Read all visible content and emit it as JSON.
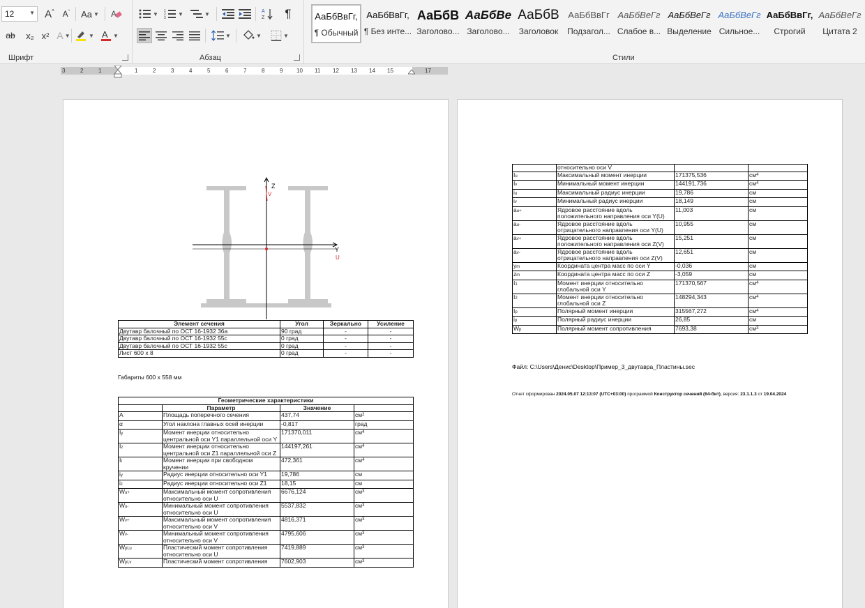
{
  "ribbon": {
    "font_size": "12",
    "font_group_label": "Шрифт",
    "para_group_label": "Абзац",
    "styles_group_label": "Стили",
    "case_label": "Aa",
    "grow_font": "A",
    "shrink_font": "A",
    "subscript": "x₂",
    "superscript": "x²",
    "font_color_letter": "A",
    "pilcrow": "¶"
  },
  "styles": [
    {
      "preview": "АаБбВвГг,",
      "name": "¶ Обычный"
    },
    {
      "preview": "АаБбВвГг,",
      "name": "¶ Без инте..."
    },
    {
      "preview": "АаБбВ",
      "name": "Заголово..."
    },
    {
      "preview": "АаБбВе",
      "name": "Заголово..."
    },
    {
      "preview": "АаБбВ",
      "name": "Заголовок"
    },
    {
      "preview": "АаБбВвГг",
      "name": "Подзагол..."
    },
    {
      "preview": "АаБбВеГг",
      "name": "Слабое в..."
    },
    {
      "preview": "АаБбВеГг",
      "name": "Выделение"
    },
    {
      "preview": "АаБбВеГг",
      "name": "Сильное..."
    },
    {
      "preview": "АаБбВвГг,",
      "name": "Строгий"
    },
    {
      "preview": "АаБбВеГг",
      "name": "Цитата 2"
    }
  ],
  "ruler": {
    "left_labels": [
      "3",
      "2",
      "1"
    ],
    "right_labels": [
      "1",
      "2",
      "3",
      "4",
      "5",
      "6",
      "7",
      "8",
      "9",
      "10",
      "11",
      "12",
      "13",
      "14",
      "15",
      "17"
    ]
  },
  "drawing": {
    "axis_z": "Z",
    "axis_y": "Y",
    "axis_v": "V",
    "axis_u": "U"
  },
  "elements_table": {
    "headers": [
      "Элемент сечения",
      "Угол",
      "Зеркально",
      "Усиление"
    ],
    "rows": [
      [
        "Двутавр балочный по ОСТ 16-1932 36а",
        "90 град",
        "-",
        "-"
      ],
      [
        "Двутавр балочный по ОСТ 16-1932 55с",
        "0 град",
        "-",
        "-"
      ],
      [
        "Двутавр балочный по ОСТ 16-1932 55с",
        "0 град",
        "-",
        "-"
      ],
      [
        "Лист 600 x 8",
        "0 град",
        "-",
        "-"
      ]
    ]
  },
  "dimensions_text": "Габариты 600 x 558 мм",
  "geom_table": {
    "title": "Геометрические характеристики",
    "headers": [
      "Параметр",
      "Значение"
    ],
    "rows": [
      {
        "sym": "A",
        "sub": "",
        "name": "Площадь поперечного сечения",
        "val": "437,74",
        "unit": "см",
        "pow": "2"
      },
      {
        "sym": "α",
        "sub": "",
        "name": "Угол наклона главных осей инерции",
        "val": "-0,817",
        "unit": "град",
        "pow": ""
      },
      {
        "sym": "I",
        "sub": "y",
        "name": "Момент инерции относительно центральной оси Y1 параллельной оси Y",
        "val": "171370,011",
        "unit": "см",
        "pow": "4"
      },
      {
        "sym": "I",
        "sub": "z",
        "name": "Момент инерции относительно центральной оси Z1 параллельной оси Z",
        "val": "144197,261",
        "unit": "см",
        "pow": "4"
      },
      {
        "sym": "I",
        "sub": "t",
        "name": "Момент инерции при свободном кручении",
        "val": "472,361",
        "unit": "см",
        "pow": "4"
      },
      {
        "sym": "i",
        "sub": "y",
        "name": "Радиус инерции относительно оси Y1",
        "val": "19,786",
        "unit": "см",
        "pow": ""
      },
      {
        "sym": "i",
        "sub": "z",
        "name": "Радиус инерции относительно оси Z1",
        "val": "18,15",
        "unit": "см",
        "pow": ""
      },
      {
        "sym": "W",
        "sub": "u+",
        "name": "Максимальный момент сопротивления относительно оси U",
        "val": "6676,124",
        "unit": "см",
        "pow": "3"
      },
      {
        "sym": "W",
        "sub": "u-",
        "name": "Минимальный момент сопротивления относительно оси U",
        "val": "5537,832",
        "unit": "см",
        "pow": "3"
      },
      {
        "sym": "W",
        "sub": "v+",
        "name": "Максимальный момент сопротивления относительно оси V",
        "val": "4816,371",
        "unit": "см",
        "pow": "3"
      },
      {
        "sym": "W",
        "sub": "v-",
        "name": "Минимальный момент сопротивления относительно оси V",
        "val": "4795,606",
        "unit": "см",
        "pow": "3"
      },
      {
        "sym": "W",
        "sub": "pl,u",
        "name": "Пластический момент сопротивления относительно оси U",
        "val": "7419,889",
        "unit": "см",
        "pow": "3"
      },
      {
        "sym": "W",
        "sub": "pl,v",
        "name": "Пластический момент сопротивления",
        "val": "7602,903",
        "unit": "см",
        "pow": "3"
      }
    ]
  },
  "geom_table_cont": {
    "rows": [
      {
        "sym": "",
        "sub": "",
        "name": "относительно оси V",
        "val": "",
        "unit": "",
        "pow": ""
      },
      {
        "sym": "I",
        "sub": "u",
        "name": "Максимальный момент инерции",
        "val": "171375,536",
        "unit": "см",
        "pow": "4"
      },
      {
        "sym": "I",
        "sub": "v",
        "name": "Минимальный момент инерции",
        "val": "144191,736",
        "unit": "см",
        "pow": "4"
      },
      {
        "sym": "i",
        "sub": "u",
        "name": "Максимальный радиус инерции",
        "val": "19,786",
        "unit": "см",
        "pow": ""
      },
      {
        "sym": "i",
        "sub": "v",
        "name": "Минимальный радиус инерции",
        "val": "18,149",
        "unit": "см",
        "pow": ""
      },
      {
        "sym": "a",
        "sub": "u+",
        "name": "Ядровое расстояние вдоль положительного направления оси Y(U)",
        "val": "11,003",
        "unit": "см",
        "pow": ""
      },
      {
        "sym": "a",
        "sub": "u-",
        "name": "Ядровое расстояние вдоль отрицательного направления оси Y(U)",
        "val": "10,955",
        "unit": "см",
        "pow": ""
      },
      {
        "sym": "a",
        "sub": "v+",
        "name": "Ядровое расстояние вдоль положительного направления оси Z(V)",
        "val": "15,251",
        "unit": "см",
        "pow": ""
      },
      {
        "sym": "a",
        "sub": "v-",
        "name": "Ядровое расстояние вдоль отрицательного направления оси Z(V)",
        "val": "12,651",
        "unit": "см",
        "pow": ""
      },
      {
        "sym": "y",
        "sub": "m",
        "name": "Координата центра масс по оси Y",
        "val": "-0,036",
        "unit": "см",
        "pow": ""
      },
      {
        "sym": "z",
        "sub": "m",
        "name": "Координата центра масс по оси Z",
        "val": "-3,059",
        "unit": "см",
        "pow": ""
      },
      {
        "sym": "I",
        "sub": "1",
        "name": "Момент инерции относительно глобальной оси Y",
        "val": "171370,567",
        "unit": "см",
        "pow": "4"
      },
      {
        "sym": "I",
        "sub": "2",
        "name": "Момент инерции относительно глобальной оси Z",
        "val": "148294,343",
        "unit": "см",
        "pow": "4"
      },
      {
        "sym": "I",
        "sub": "p",
        "name": "Полярный момент инерции",
        "val": "315567,272",
        "unit": "см",
        "pow": "4"
      },
      {
        "sym": "i",
        "sub": "p",
        "name": "Полярный радиус инерции",
        "val": "26,85",
        "unit": "см",
        "pow": ""
      },
      {
        "sym": "W",
        "sub": "p",
        "name": "Полярный момент сопротивления",
        "val": "7693,38",
        "unit": "см",
        "pow": "3"
      }
    ]
  },
  "file_line": "Файл: C:\\Users\\Денис\\Desktop\\Пример_3_двутавра_Пластины.sec",
  "report": {
    "p1": "Отчет сформирован ",
    "date": "2024.05.07 12:13:07 (UTC+03:00)",
    "p2": " программой ",
    "program": "Конструктор сечений (64-бит)",
    "p3": ", версия: ",
    "version": "23.1.1.3",
    "p4": " от ",
    "build_date": "19.04.2024"
  },
  "colors": {
    "accent_red": "#d42a2a",
    "shape_gray": "#c8c8c8",
    "ribbon_bg": "#f3f3f3",
    "page_bg": "#e9e9e9"
  }
}
